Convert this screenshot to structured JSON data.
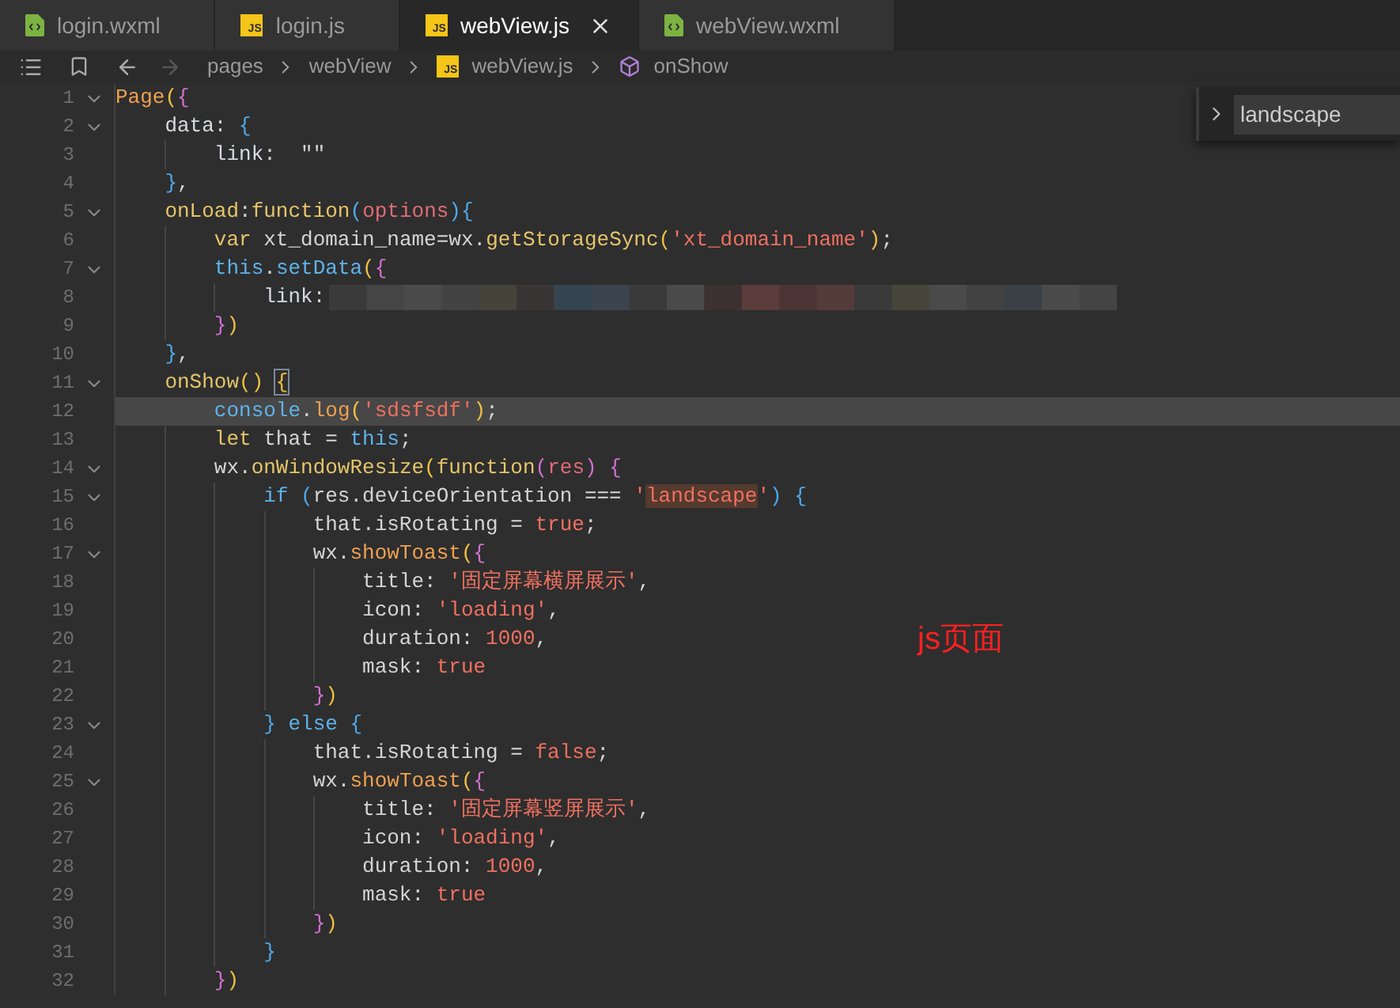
{
  "tabs": [
    {
      "label": "login.wxml",
      "kind": "wxml",
      "selected": false
    },
    {
      "label": "login.js",
      "kind": "js",
      "icon_text": "JS",
      "selected": false
    },
    {
      "label": "webView.js",
      "kind": "js",
      "icon_text": "JS",
      "selected": true
    },
    {
      "label": "webView.wxml",
      "kind": "wxml",
      "selected": false
    }
  ],
  "breadcrumb": {
    "back_disabled": false,
    "forward_disabled": true,
    "items": [
      {
        "label": "pages",
        "kind": "folder"
      },
      {
        "label": "webView",
        "kind": "folder"
      },
      {
        "label": "webView.js",
        "kind": "js",
        "icon_text": "JS"
      },
      {
        "label": "onShow",
        "kind": "method"
      }
    ]
  },
  "find": {
    "value": "landscape"
  },
  "annotation": "js页面",
  "lines": [
    {
      "n": "1",
      "fold": true,
      "current": false,
      "redacted": false,
      "tokens": [
        {
          "text": "Page",
          "kind": "fn"
        },
        {
          "text": "(",
          "kind": "b1"
        },
        {
          "text": "{",
          "kind": "b2"
        }
      ]
    },
    {
      "n": "2",
      "fold": true,
      "current": false,
      "redacted": false,
      "tokens": [
        {
          "text": "    data",
          "kind": "prop"
        },
        {
          "text": ": ",
          "kind": "plain"
        },
        {
          "text": "{",
          "kind": "b3"
        }
      ]
    },
    {
      "n": "3",
      "fold": false,
      "current": false,
      "redacted": false,
      "tokens": [
        {
          "text": "        link",
          "kind": "prop"
        },
        {
          "text": ":  \"\"",
          "kind": "plain"
        }
      ]
    },
    {
      "n": "4",
      "fold": false,
      "current": false,
      "redacted": false,
      "tokens": [
        {
          "text": "    }",
          "kind": "b3"
        },
        {
          "text": ",",
          "kind": "plain"
        }
      ]
    },
    {
      "n": "5",
      "fold": true,
      "current": false,
      "redacted": false,
      "tokens": [
        {
          "text": "    onLoad",
          "kind": "key"
        },
        {
          "text": ":",
          "kind": "plain"
        },
        {
          "text": "function",
          "kind": "key"
        },
        {
          "text": "(",
          "kind": "b3"
        },
        {
          "text": "options",
          "kind": "param"
        },
        {
          "text": ")",
          "kind": "b3"
        },
        {
          "text": "{",
          "kind": "b3"
        }
      ]
    },
    {
      "n": "6",
      "fold": false,
      "current": false,
      "redacted": false,
      "tokens": [
        {
          "text": "        var",
          "kind": "key"
        },
        {
          "text": " xt_domain_name=wx.",
          "kind": "plain"
        },
        {
          "text": "getStorageSync",
          "kind": "key"
        },
        {
          "text": "(",
          "kind": "b1"
        },
        {
          "text": "'xt_domain_name'",
          "kind": "str"
        },
        {
          "text": ")",
          "kind": "b1"
        },
        {
          "text": ";",
          "kind": "plain"
        }
      ]
    },
    {
      "n": "7",
      "fold": true,
      "current": false,
      "redacted": false,
      "tokens": [
        {
          "text": "        this",
          "kind": "kw2"
        },
        {
          "text": ".",
          "kind": "plain"
        },
        {
          "text": "setData",
          "kind": "kw2"
        },
        {
          "text": "(",
          "kind": "b1"
        },
        {
          "text": "{",
          "kind": "b2"
        }
      ]
    },
    {
      "n": "8",
      "fold": false,
      "current": false,
      "redacted": true,
      "tokens": [
        {
          "text": "            link",
          "kind": "prop"
        },
        {
          "text": ":",
          "kind": "plain"
        }
      ]
    },
    {
      "n": "9",
      "fold": false,
      "current": false,
      "redacted": false,
      "tokens": [
        {
          "text": "        }",
          "kind": "b2"
        },
        {
          "text": ")",
          "kind": "b1"
        }
      ]
    },
    {
      "n": "10",
      "fold": false,
      "current": false,
      "redacted": false,
      "tokens": [
        {
          "text": "    }",
          "kind": "b3"
        },
        {
          "text": ",",
          "kind": "plain"
        }
      ]
    },
    {
      "n": "11",
      "fold": true,
      "current": false,
      "redacted": false,
      "tokens": [
        {
          "text": "    onShow",
          "kind": "key"
        },
        {
          "text": "() ",
          "kind": "b1"
        },
        {
          "text": "{",
          "kind": "bracket"
        }
      ]
    },
    {
      "n": "12",
      "fold": false,
      "current": true,
      "redacted": false,
      "tokens": [
        {
          "text": "        console",
          "kind": "kw2"
        },
        {
          "text": ".",
          "kind": "plain"
        },
        {
          "text": "log",
          "kind": "fn"
        },
        {
          "text": "(",
          "kind": "b1"
        },
        {
          "text": "'sdsfsdf'",
          "kind": "str"
        },
        {
          "text": ")",
          "kind": "b1"
        },
        {
          "text": ";",
          "kind": "plain"
        }
      ]
    },
    {
      "n": "13",
      "fold": false,
      "current": false,
      "redacted": false,
      "tokens": [
        {
          "text": "        let",
          "kind": "key"
        },
        {
          "text": " that = ",
          "kind": "plain"
        },
        {
          "text": "this",
          "kind": "kw2"
        },
        {
          "text": ";",
          "kind": "plain"
        }
      ]
    },
    {
      "n": "14",
      "fold": true,
      "current": false,
      "redacted": false,
      "tokens": [
        {
          "text": "        wx.",
          "kind": "plain"
        },
        {
          "text": "onWindowResize",
          "kind": "key"
        },
        {
          "text": "(",
          "kind": "b1"
        },
        {
          "text": "function",
          "kind": "key"
        },
        {
          "text": "(",
          "kind": "b2"
        },
        {
          "text": "res",
          "kind": "param"
        },
        {
          "text": ") {",
          "kind": "b2"
        }
      ]
    },
    {
      "n": "15",
      "fold": true,
      "current": false,
      "redacted": false,
      "tokens": [
        {
          "text": "            if",
          "kind": "kw2"
        },
        {
          "text": " (",
          "kind": "b3"
        },
        {
          "text": "res.deviceOrientation === ",
          "kind": "plain"
        },
        {
          "text": "'",
          "kind": "str"
        },
        {
          "text": "landscape",
          "kind": "match"
        },
        {
          "text": "'",
          "kind": "str"
        },
        {
          "text": ") {",
          "kind": "b3"
        }
      ]
    },
    {
      "n": "16",
      "fold": false,
      "current": false,
      "redacted": false,
      "tokens": [
        {
          "text": "                that.isRotating = ",
          "kind": "plain"
        },
        {
          "text": "true",
          "kind": "num"
        },
        {
          "text": ";",
          "kind": "plain"
        }
      ]
    },
    {
      "n": "17",
      "fold": true,
      "current": false,
      "redacted": false,
      "tokens": [
        {
          "text": "                wx.",
          "kind": "plain"
        },
        {
          "text": "showToast",
          "kind": "fn"
        },
        {
          "text": "(",
          "kind": "b1"
        },
        {
          "text": "{",
          "kind": "b2"
        }
      ]
    },
    {
      "n": "18",
      "fold": false,
      "current": false,
      "redacted": false,
      "tokens": [
        {
          "text": "                    title: ",
          "kind": "plain"
        },
        {
          "text": "'固定屏幕横屏展示'",
          "kind": "str"
        },
        {
          "text": ",",
          "kind": "plain"
        }
      ]
    },
    {
      "n": "19",
      "fold": false,
      "current": false,
      "redacted": false,
      "tokens": [
        {
          "text": "                    icon: ",
          "kind": "plain"
        },
        {
          "text": "'loading'",
          "kind": "str"
        },
        {
          "text": ",",
          "kind": "plain"
        }
      ]
    },
    {
      "n": "20",
      "fold": false,
      "current": false,
      "redacted": false,
      "tokens": [
        {
          "text": "                    duration: ",
          "kind": "plain"
        },
        {
          "text": "1000",
          "kind": "num"
        },
        {
          "text": ",",
          "kind": "plain"
        }
      ]
    },
    {
      "n": "21",
      "fold": false,
      "current": false,
      "redacted": false,
      "tokens": [
        {
          "text": "                    mask: ",
          "kind": "plain"
        },
        {
          "text": "true",
          "kind": "num"
        }
      ]
    },
    {
      "n": "22",
      "fold": false,
      "current": false,
      "redacted": false,
      "tokens": [
        {
          "text": "                }",
          "kind": "b2"
        },
        {
          "text": ")",
          "kind": "b1"
        }
      ]
    },
    {
      "n": "23",
      "fold": true,
      "current": false,
      "redacted": false,
      "tokens": [
        {
          "text": "            }",
          "kind": "b3"
        },
        {
          "text": " else ",
          "kind": "kw2"
        },
        {
          "text": "{",
          "kind": "b3"
        }
      ]
    },
    {
      "n": "24",
      "fold": false,
      "current": false,
      "redacted": false,
      "tokens": [
        {
          "text": "                that.isRotating = ",
          "kind": "plain"
        },
        {
          "text": "false",
          "kind": "num"
        },
        {
          "text": ";",
          "kind": "plain"
        }
      ]
    },
    {
      "n": "25",
      "fold": true,
      "current": false,
      "redacted": false,
      "tokens": [
        {
          "text": "                wx.",
          "kind": "plain"
        },
        {
          "text": "showToast",
          "kind": "fn"
        },
        {
          "text": "(",
          "kind": "b1"
        },
        {
          "text": "{",
          "kind": "b2"
        }
      ]
    },
    {
      "n": "26",
      "fold": false,
      "current": false,
      "redacted": false,
      "tokens": [
        {
          "text": "                    title: ",
          "kind": "plain"
        },
        {
          "text": "'固定屏幕竖屏展示'",
          "kind": "str"
        },
        {
          "text": ",",
          "kind": "plain"
        }
      ]
    },
    {
      "n": "27",
      "fold": false,
      "current": false,
      "redacted": false,
      "tokens": [
        {
          "text": "                    icon: ",
          "kind": "plain"
        },
        {
          "text": "'loading'",
          "kind": "str"
        },
        {
          "text": ",",
          "kind": "plain"
        }
      ]
    },
    {
      "n": "28",
      "fold": false,
      "current": false,
      "redacted": false,
      "tokens": [
        {
          "text": "                    duration: ",
          "kind": "plain"
        },
        {
          "text": "1000",
          "kind": "num"
        },
        {
          "text": ",",
          "kind": "plain"
        }
      ]
    },
    {
      "n": "29",
      "fold": false,
      "current": false,
      "redacted": false,
      "tokens": [
        {
          "text": "                    mask: ",
          "kind": "plain"
        },
        {
          "text": "true",
          "kind": "num"
        }
      ]
    },
    {
      "n": "30",
      "fold": false,
      "current": false,
      "redacted": false,
      "tokens": [
        {
          "text": "                }",
          "kind": "b2"
        },
        {
          "text": ")",
          "kind": "b1"
        }
      ]
    },
    {
      "n": "31",
      "fold": false,
      "current": false,
      "redacted": false,
      "tokens": [
        {
          "text": "            }",
          "kind": "b3"
        }
      ]
    },
    {
      "n": "32",
      "fold": false,
      "current": false,
      "redacted": false,
      "tokens": [
        {
          "text": "        }",
          "kind": "b2"
        },
        {
          "text": ")",
          "kind": "b1"
        }
      ]
    }
  ]
}
